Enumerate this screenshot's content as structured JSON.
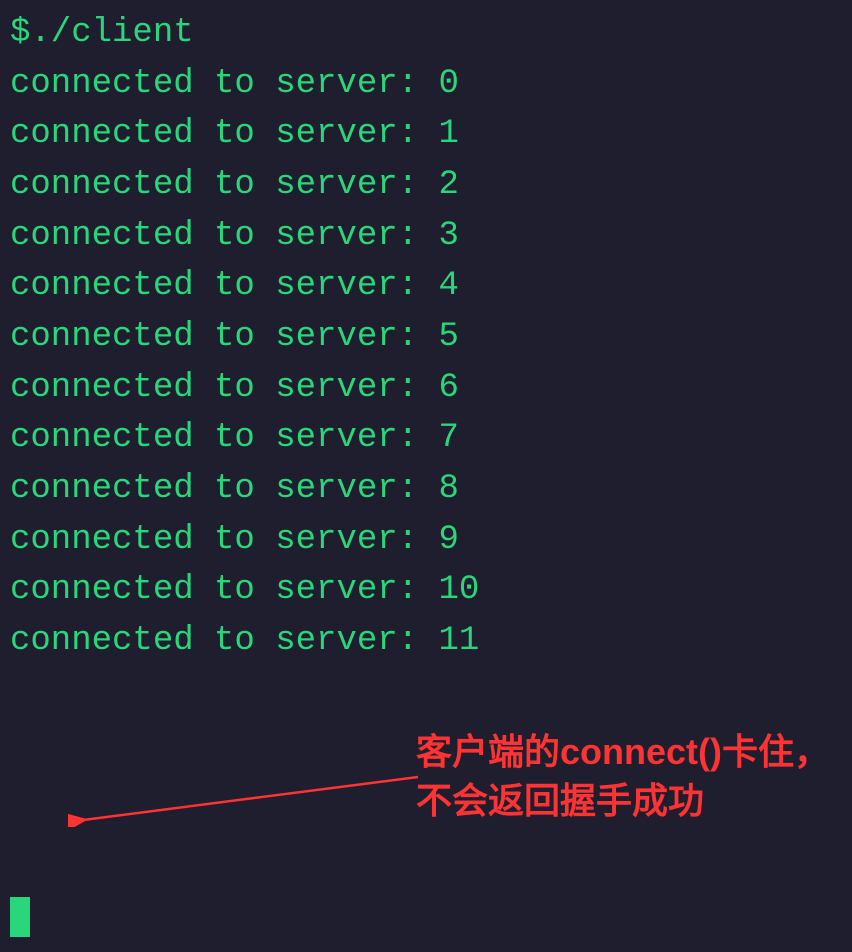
{
  "terminal": {
    "prompt": "$./client",
    "lines": [
      "connected to server: 0",
      "connected to server: 1",
      "connected to server: 2",
      "connected to server: 3",
      "connected to server: 4",
      "connected to server: 5",
      "connected to server: 6",
      "connected to server: 7",
      "connected to server: 8",
      "connected to server: 9",
      "connected to server: 10",
      "connected to server: 11"
    ]
  },
  "annotation": {
    "text": "客户端的connect()卡住，不会返回握手成功"
  }
}
